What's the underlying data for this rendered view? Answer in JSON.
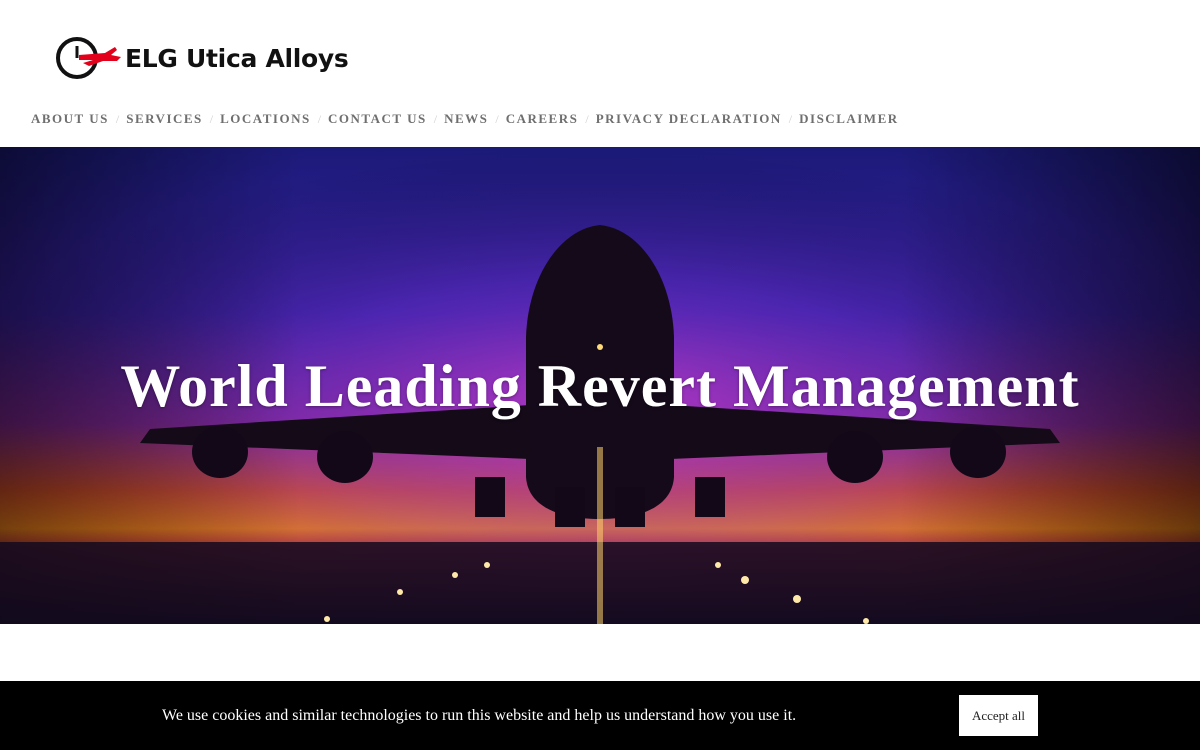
{
  "brand": {
    "name": "ELG Utica Alloys",
    "logo_icon": "plane-clock-logo-icon",
    "accent_color": "#e3001b"
  },
  "nav": {
    "items": [
      {
        "label": "ABOUT US"
      },
      {
        "label": "SERVICES"
      },
      {
        "label": "LOCATIONS"
      },
      {
        "label": "CONTACT US"
      },
      {
        "label": "NEWS"
      },
      {
        "label": "CAREERS"
      },
      {
        "label": "PRIVACY DECLARATION"
      },
      {
        "label": "DISCLAIMER"
      }
    ],
    "separator": "/"
  },
  "hero": {
    "title": "World Leading Revert Management",
    "image": "airplane-landing-sunset"
  },
  "cookie_banner": {
    "message": "We use cookies and similar technologies to run this website and help us understand how you use it.",
    "accept_label": "Accept all"
  }
}
